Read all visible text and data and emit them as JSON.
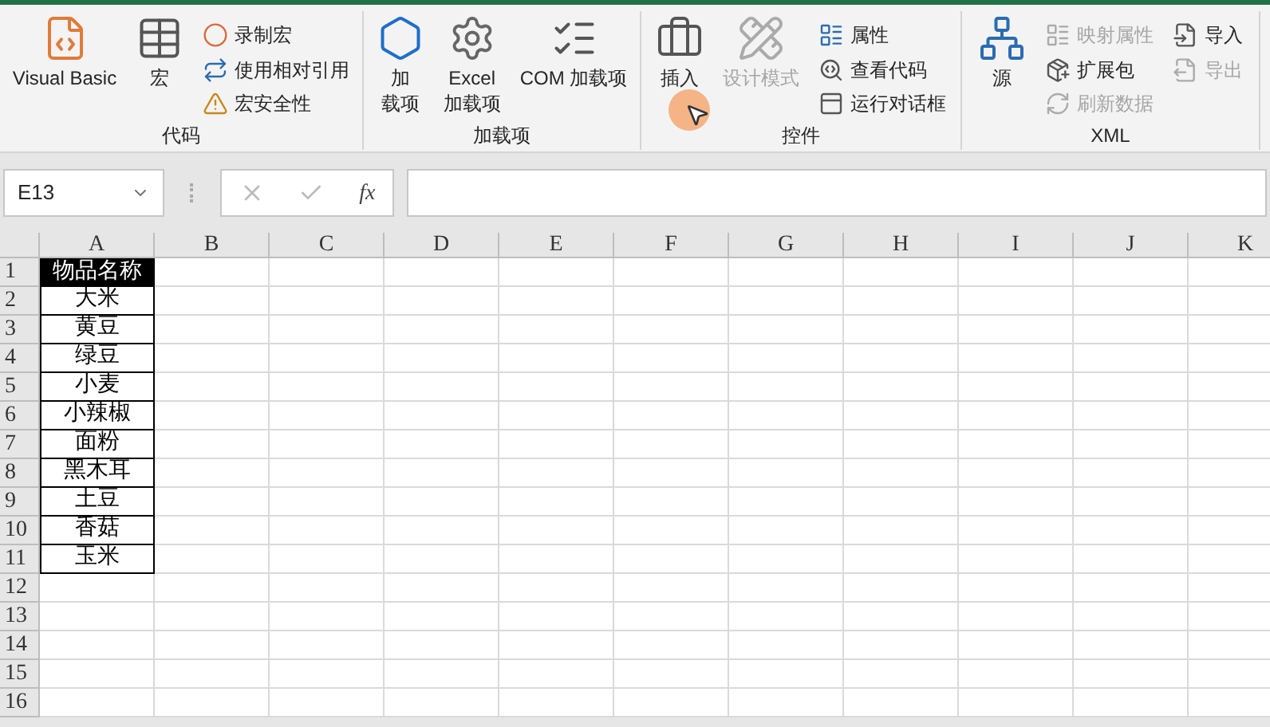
{
  "ribbon": {
    "groups": [
      {
        "label": "代码",
        "items": [
          {
            "kind": "large",
            "lines": [
              "Visual Basic"
            ],
            "disabled": false
          },
          {
            "kind": "large",
            "lines": [
              "宏"
            ],
            "disabled": false
          },
          {
            "kind": "small",
            "lines": [
              "录制宏"
            ],
            "disabled": false
          },
          {
            "kind": "small",
            "lines": [
              "使用相对引用"
            ],
            "disabled": false
          },
          {
            "kind": "small",
            "lines": [
              "宏安全性"
            ],
            "disabled": false
          }
        ]
      },
      {
        "label": "加载项",
        "items": [
          {
            "kind": "large",
            "lines": [
              "加",
              "载项"
            ],
            "disabled": false
          },
          {
            "kind": "large",
            "lines": [
              "Excel",
              "加载项"
            ],
            "disabled": false
          },
          {
            "kind": "large",
            "lines": [
              "COM 加载项"
            ],
            "disabled": false
          }
        ]
      },
      {
        "label": "控件",
        "items": [
          {
            "kind": "large",
            "lines": [
              "插入"
            ],
            "disabled": false
          },
          {
            "kind": "large",
            "lines": [
              "设计模式"
            ],
            "disabled": true
          },
          {
            "kind": "small",
            "lines": [
              "属性"
            ],
            "disabled": false
          },
          {
            "kind": "small",
            "lines": [
              "查看代码"
            ],
            "disabled": false
          },
          {
            "kind": "small",
            "lines": [
              "运行对话框"
            ],
            "disabled": false
          }
        ]
      },
      {
        "label": "XML",
        "items": [
          {
            "kind": "large",
            "lines": [
              "源"
            ],
            "disabled": false
          },
          {
            "kind": "small",
            "lines": [
              "映射属性"
            ],
            "disabled": true
          },
          {
            "kind": "small",
            "lines": [
              "扩展包"
            ],
            "disabled": false
          },
          {
            "kind": "small",
            "lines": [
              "刷新数据"
            ],
            "disabled": true
          },
          {
            "kind": "small",
            "lines": [
              "导入"
            ],
            "disabled": false
          },
          {
            "kind": "small",
            "lines": [
              "导出"
            ],
            "disabled": true
          }
        ]
      }
    ]
  },
  "formula_bar": {
    "name_box": "E13",
    "function_button": "fx"
  },
  "sheet": {
    "columns": [
      "A",
      "B",
      "C",
      "D",
      "E",
      "F",
      "G",
      "H",
      "I",
      "J",
      "K"
    ],
    "rows": [
      {
        "number": "1",
        "cells": [
          {
            "text": "物品名称",
            "kind": "header"
          }
        ]
      },
      {
        "number": "2",
        "cells": [
          {
            "text": "大米",
            "kind": "data"
          }
        ]
      },
      {
        "number": "3",
        "cells": [
          {
            "text": "黄豆",
            "kind": "data"
          }
        ]
      },
      {
        "number": "4",
        "cells": [
          {
            "text": "绿豆",
            "kind": "data"
          }
        ]
      },
      {
        "number": "5",
        "cells": [
          {
            "text": "小麦",
            "kind": "data"
          }
        ]
      },
      {
        "number": "6",
        "cells": [
          {
            "text": "小辣椒",
            "kind": "data"
          }
        ]
      },
      {
        "number": "7",
        "cells": [
          {
            "text": "面粉",
            "kind": "data"
          }
        ]
      },
      {
        "number": "8",
        "cells": [
          {
            "text": "黑木耳",
            "kind": "data"
          }
        ]
      },
      {
        "number": "9",
        "cells": [
          {
            "text": "土豆",
            "kind": "data"
          }
        ]
      },
      {
        "number": "10",
        "cells": [
          {
            "text": "香菇",
            "kind": "data"
          }
        ]
      },
      {
        "number": "11",
        "cells": [
          {
            "text": "玉米",
            "kind": "data"
          }
        ]
      },
      {
        "number": "12"
      },
      {
        "number": "13"
      },
      {
        "number": "14"
      },
      {
        "number": "15"
      },
      {
        "number": "16"
      }
    ]
  }
}
